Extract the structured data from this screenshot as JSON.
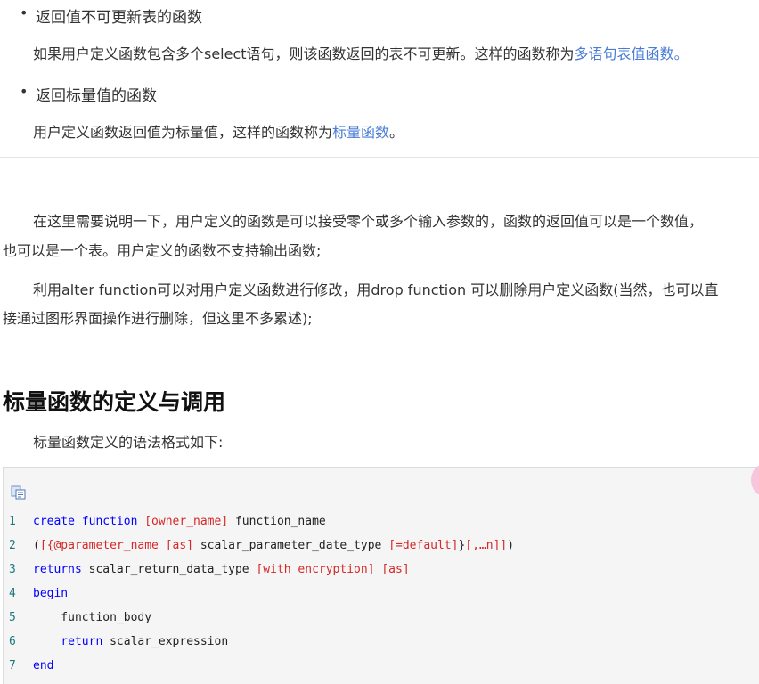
{
  "bullets": [
    {
      "title": "返回值不可更新表的函数",
      "desc_before": "如果用户定义函数包含多个select语句，则该函数返回的表不可更新。这样的函数称为",
      "desc_link": "多语句表值函数",
      "desc_after": "。"
    },
    {
      "title": "返回标量值的函数",
      "desc_before": "用户定义函数返回值为标量值，这样的函数称为",
      "desc_link": "标量函数",
      "desc_after": "。"
    }
  ],
  "paragraphs": [
    {
      "line1": "在这里需要说明一下，用户定义的函数是可以接受零个或多个输入参数的，函数的返回值可以是一个数值，",
      "line2": "也可以是一个表。用户定义的函数不支持输出函数;"
    },
    {
      "line1": "利用alter function可以对用户定义函数进行修改，用drop function 可以删除用户定义函数(当然，也可以直",
      "line2": "接通过图形界面操作进行删除，但这里不多累述);"
    }
  ],
  "section": {
    "heading": "标量函数的定义与调用",
    "intro": "标量函数定义的语法格式如下:"
  },
  "code": {
    "copy_icon": "copy-icon",
    "lines": [
      {
        "num": "1",
        "segs": [
          {
            "t": "create function ",
            "c": "kw"
          },
          {
            "t": "[owner_name]",
            "c": "op"
          },
          {
            "t": " function_name",
            "c": "tx"
          }
        ]
      },
      {
        "num": "2",
        "segs": [
          {
            "t": "(",
            "c": "tx"
          },
          {
            "t": "[{@parameter_name ",
            "c": "op"
          },
          {
            "t": "[as]",
            "c": "op"
          },
          {
            "t": " scalar_parameter_date_type ",
            "c": "tx"
          },
          {
            "t": "[=default]",
            "c": "op"
          },
          {
            "t": "}",
            "c": "tx"
          },
          {
            "t": "[,…n]]",
            "c": "op"
          },
          {
            "t": ")",
            "c": "tx"
          }
        ]
      },
      {
        "num": "3",
        "segs": [
          {
            "t": "returns",
            "c": "kw"
          },
          {
            "t": " scalar_return_data_type ",
            "c": "tx"
          },
          {
            "t": "[with encryption]",
            "c": "op"
          },
          {
            "t": " ",
            "c": "tx"
          },
          {
            "t": "[as]",
            "c": "op"
          }
        ]
      },
      {
        "num": "4",
        "segs": [
          {
            "t": "begin",
            "c": "kw"
          }
        ]
      },
      {
        "num": "5",
        "segs": [
          {
            "t": "    function_body",
            "c": "tx"
          }
        ]
      },
      {
        "num": "6",
        "segs": [
          {
            "t": "    ",
            "c": "tx"
          },
          {
            "t": "return",
            "c": "kw"
          },
          {
            "t": " scalar_expression",
            "c": "tx"
          }
        ]
      },
      {
        "num": "7",
        "segs": [
          {
            "t": "end",
            "c": "kw"
          }
        ]
      }
    ]
  }
}
